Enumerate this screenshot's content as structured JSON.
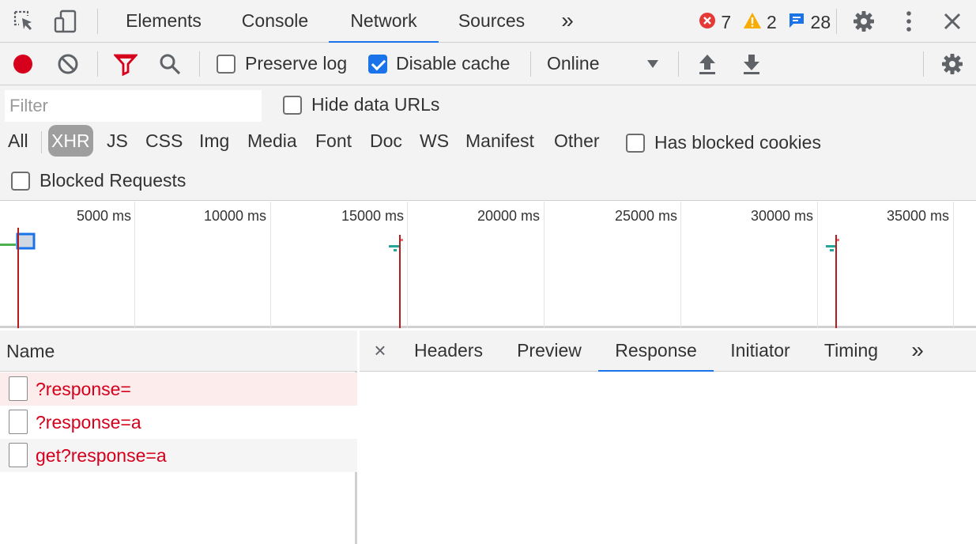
{
  "tabs": [
    {
      "label": "Elements"
    },
    {
      "label": "Console"
    },
    {
      "label": "Network"
    },
    {
      "label": "Sources"
    }
  ],
  "tabs_more": "»",
  "counts": {
    "errors": "7",
    "warnings": "2",
    "messages": "28"
  },
  "toolbar": {
    "preserve_log": "Preserve log",
    "disable_cache": "Disable cache",
    "throttle": "Online"
  },
  "filter": {
    "placeholder": "Filter",
    "hide_data_urls": "Hide data URLs",
    "types": [
      "All",
      "XHR",
      "JS",
      "CSS",
      "Img",
      "Media",
      "Font",
      "Doc",
      "WS",
      "Manifest",
      "Other"
    ],
    "has_blocked_cookies": "Has blocked cookies",
    "blocked_requests": "Blocked Requests"
  },
  "overview": {
    "ticks": [
      "5000 ms",
      "10000 ms",
      "15000 ms",
      "20000 ms",
      "25000 ms",
      "30000 ms",
      "35000 ms"
    ]
  },
  "requests": {
    "header": "Name",
    "rows": [
      {
        "name": "?response="
      },
      {
        "name": "?response=a"
      },
      {
        "name": "get?response=a"
      }
    ]
  },
  "detail": {
    "close": "×",
    "tabs": [
      {
        "label": "Headers"
      },
      {
        "label": "Preview"
      },
      {
        "label": "Response"
      },
      {
        "label": "Initiator"
      },
      {
        "label": "Timing"
      }
    ],
    "more": "»"
  },
  "colors": {
    "accent": "#1a73e8",
    "error_text": "#d6001c",
    "record": "#d6001c"
  },
  "icons": [
    "inspect-icon",
    "device-icon",
    "error-icon",
    "warning-icon",
    "message-icon",
    "settings-icon",
    "kebab-icon",
    "close-icon",
    "record-icon",
    "clear-icon",
    "filter-icon",
    "search-icon",
    "upload-icon",
    "download-icon",
    "file-icon"
  ]
}
